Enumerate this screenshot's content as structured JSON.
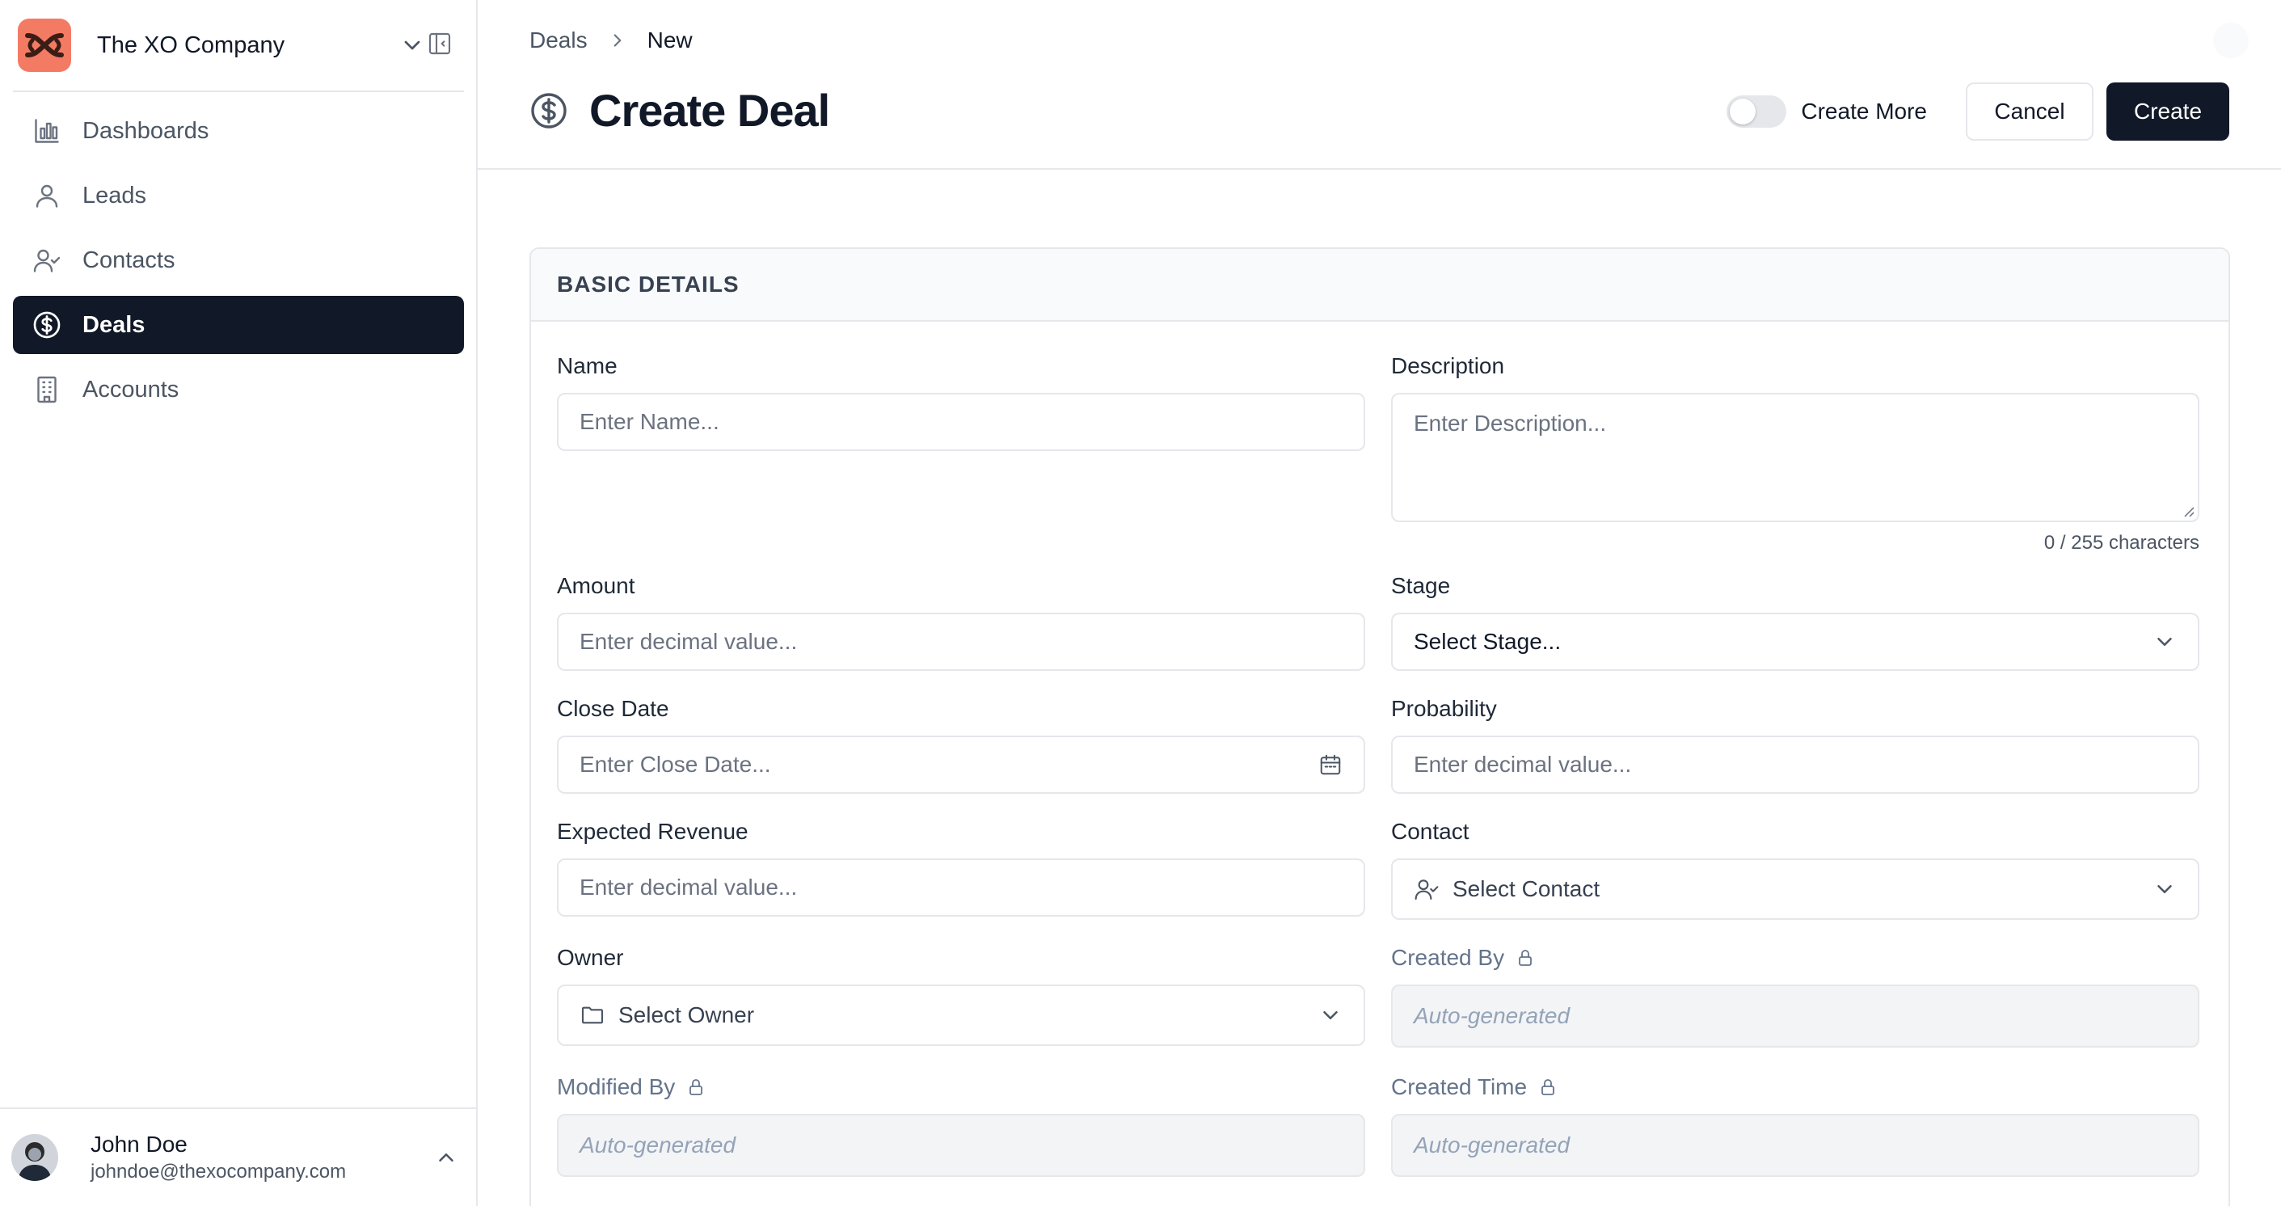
{
  "org": {
    "name": "The XO Company"
  },
  "sidebar": {
    "items": [
      {
        "label": "Dashboards",
        "icon": "bar-chart-icon",
        "active": false
      },
      {
        "label": "Leads",
        "icon": "user-icon",
        "active": false
      },
      {
        "label": "Contacts",
        "icon": "user-check-icon",
        "active": false
      },
      {
        "label": "Deals",
        "icon": "dollar-circle-icon",
        "active": true
      },
      {
        "label": "Accounts",
        "icon": "building-icon",
        "active": false
      }
    ]
  },
  "user": {
    "name": "John Doe",
    "email": "johndoe@thexocompany.com"
  },
  "breadcrumb": {
    "parent": "Deals",
    "current": "New"
  },
  "page": {
    "title": "Create Deal"
  },
  "actions": {
    "create_more_label": "Create More",
    "create_more_on": false,
    "cancel_label": "Cancel",
    "create_label": "Create"
  },
  "form": {
    "section_title": "BASIC DETAILS",
    "name": {
      "label": "Name",
      "placeholder": "Enter Name..."
    },
    "description": {
      "label": "Description",
      "placeholder": "Enter Description...",
      "char_count": "0 / 255 characters"
    },
    "amount": {
      "label": "Amount",
      "placeholder": "Enter decimal value..."
    },
    "stage": {
      "label": "Stage",
      "value": "Select Stage..."
    },
    "close_date": {
      "label": "Close Date",
      "placeholder": "Enter Close Date..."
    },
    "probability": {
      "label": "Probability",
      "placeholder": "Enter decimal value..."
    },
    "expected_revenue": {
      "label": "Expected Revenue",
      "placeholder": "Enter decimal value..."
    },
    "contact": {
      "label": "Contact",
      "value": "Select Contact"
    },
    "owner": {
      "label": "Owner",
      "value": "Select Owner"
    },
    "created_by": {
      "label": "Created By",
      "value": "Auto-generated"
    },
    "modified_by": {
      "label": "Modified By",
      "value": "Auto-generated"
    },
    "created_time": {
      "label": "Created Time",
      "value": "Auto-generated"
    }
  },
  "colors": {
    "accent": "#111827",
    "logo": "#f47b63",
    "border": "#e5e7eb"
  }
}
